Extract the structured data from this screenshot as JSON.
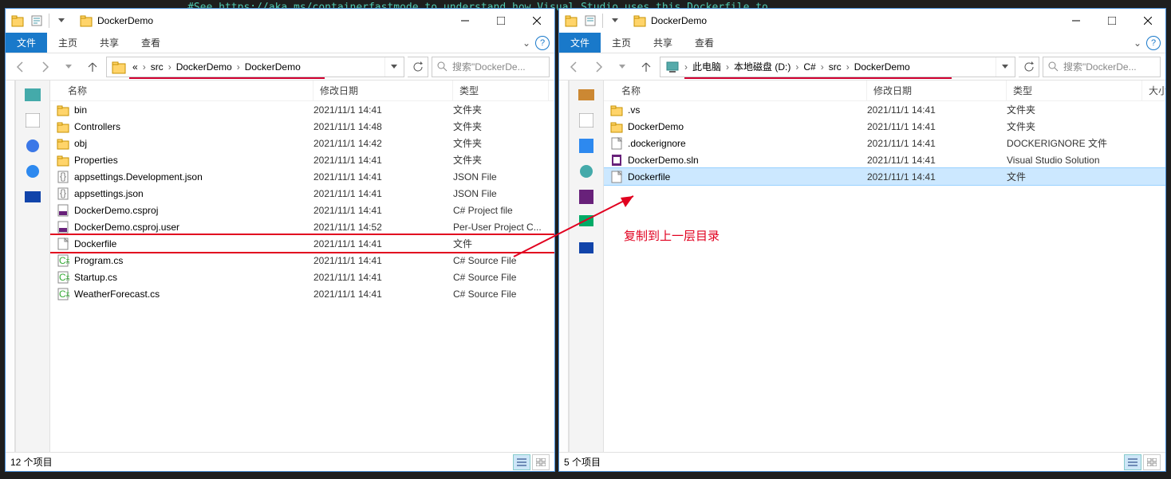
{
  "bg_text": "#See https://aka.ms/containerfastmode to understand how Visual Studio uses this Dockerfile to ...",
  "window1": {
    "title": "DockerDemo",
    "tabs": {
      "file": "文件",
      "home": "主页",
      "share": "共享",
      "view": "查看"
    },
    "breadcrumb": [
      "«",
      "src",
      "DockerDemo",
      "DockerDemo"
    ],
    "search_placeholder": "搜索\"DockerDe...",
    "columns": {
      "name": "名称",
      "date": "修改日期",
      "type": "类型"
    },
    "rows": [
      {
        "icon": "folder",
        "name": "bin",
        "date": "2021/11/1 14:41",
        "type": "文件夹"
      },
      {
        "icon": "folder",
        "name": "Controllers",
        "date": "2021/11/1 14:48",
        "type": "文件夹"
      },
      {
        "icon": "folder",
        "name": "obj",
        "date": "2021/11/1 14:42",
        "type": "文件夹"
      },
      {
        "icon": "folder",
        "name": "Properties",
        "date": "2021/11/1 14:41",
        "type": "文件夹"
      },
      {
        "icon": "json",
        "name": "appsettings.Development.json",
        "date": "2021/11/1 14:41",
        "type": "JSON File"
      },
      {
        "icon": "json",
        "name": "appsettings.json",
        "date": "2021/11/1 14:41",
        "type": "JSON File"
      },
      {
        "icon": "csproj",
        "name": "DockerDemo.csproj",
        "date": "2021/11/1 14:41",
        "type": "C# Project file"
      },
      {
        "icon": "csproj",
        "name": "DockerDemo.csproj.user",
        "date": "2021/11/1 14:52",
        "type": "Per-User Project C..."
      },
      {
        "icon": "file",
        "name": "Dockerfile",
        "date": "2021/11/1 14:41",
        "type": "文件",
        "boxed": true
      },
      {
        "icon": "cs",
        "name": "Program.cs",
        "date": "2021/11/1 14:41",
        "type": "C# Source File"
      },
      {
        "icon": "cs",
        "name": "Startup.cs",
        "date": "2021/11/1 14:41",
        "type": "C# Source File"
      },
      {
        "icon": "cs",
        "name": "WeatherForecast.cs",
        "date": "2021/11/1 14:41",
        "type": "C# Source File"
      }
    ],
    "status": "12 个项目"
  },
  "window2": {
    "title": "DockerDemo",
    "tabs": {
      "file": "文件",
      "home": "主页",
      "share": "共享",
      "view": "查看"
    },
    "breadcrumb": [
      "此电脑",
      "本地磁盘 (D:)",
      "C#",
      "src",
      "DockerDemo"
    ],
    "search_placeholder": "搜索\"DockerDe...",
    "columns": {
      "name": "名称",
      "date": "修改日期",
      "type": "类型",
      "size": "大小"
    },
    "rows": [
      {
        "icon": "folder",
        "name": ".vs",
        "date": "2021/11/1 14:41",
        "type": "文件夹"
      },
      {
        "icon": "folder",
        "name": "DockerDemo",
        "date": "2021/11/1 14:41",
        "type": "文件夹"
      },
      {
        "icon": "file",
        "name": ".dockerignore",
        "date": "2021/11/1 14:41",
        "type": "DOCKERIGNORE 文件"
      },
      {
        "icon": "sln",
        "name": "DockerDemo.sln",
        "date": "2021/11/1 14:41",
        "type": "Visual Studio Solution"
      },
      {
        "icon": "file",
        "name": "Dockerfile",
        "date": "2021/11/1 14:41",
        "type": "文件",
        "selected": true
      }
    ],
    "status": "5 个项目"
  },
  "annotation_text": "复制到上一层目录"
}
